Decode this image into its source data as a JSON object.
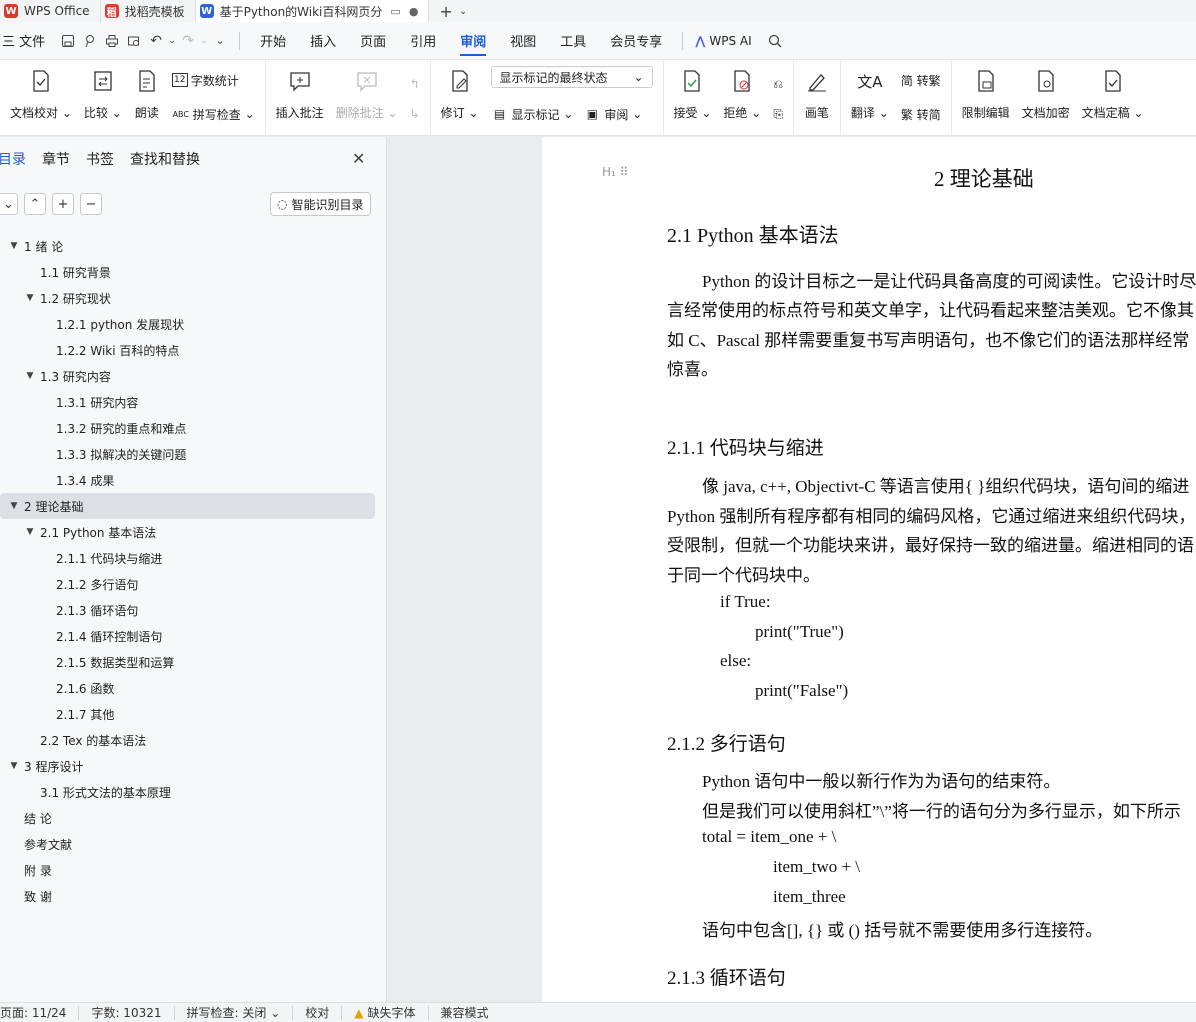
{
  "tabs": [
    {
      "label": "WPS Office",
      "color": "#d83b2a",
      "glyph": "W"
    },
    {
      "label": "找稻壳模板",
      "color": "#e53935",
      "glyph": "稻"
    },
    {
      "label": "基于Python的Wiki百科网页分",
      "color": "#2f64d8",
      "glyph": "W"
    }
  ],
  "menu": {
    "file": "三 文件",
    "items": [
      "开始",
      "插入",
      "页面",
      "引用",
      "审阅",
      "视图",
      "工具",
      "会员专享"
    ],
    "active": "审阅",
    "wps_ai": "WPS AI"
  },
  "ribbon": {
    "doc_check": "文档校对",
    "compare": "比较",
    "read_aloud": "朗读",
    "word_count": "字数统计",
    "spell_check": "拼写检查",
    "insert_comment": "插入批注",
    "delete_comment": "删除批注",
    "revise": "修订",
    "display_state": "显示标记的最终状态",
    "show_markup": "显示标记",
    "review": "审阅",
    "accept": "接受",
    "reject": "拒绝",
    "pen": "画笔",
    "translate": "翻译",
    "to_traditional": "简 转繁",
    "to_simplified": "繁 转简",
    "restrict_edit": "限制编辑",
    "encrypt": "文档加密",
    "finalize": "文档定稿"
  },
  "nav": {
    "tabs": [
      "目录",
      "章节",
      "书签",
      "查找和替换"
    ],
    "smart_toc": "智能识别目录",
    "toc": [
      {
        "level": 1,
        "caret": true,
        "text": "1 绪 论"
      },
      {
        "level": 2,
        "caret": false,
        "text": "1.1 研究背景"
      },
      {
        "level": 2,
        "caret": true,
        "text": "1.2 研究现状"
      },
      {
        "level": 3,
        "caret": false,
        "text": "1.2.1 python 发展现状"
      },
      {
        "level": 3,
        "caret": false,
        "text": "1.2.2 Wiki 百科的特点"
      },
      {
        "level": 2,
        "caret": true,
        "text": "1.3 研究内容"
      },
      {
        "level": 3,
        "caret": false,
        "text": "1.3.1 研究内容"
      },
      {
        "level": 3,
        "caret": false,
        "text": "1.3.2 研究的重点和难点"
      },
      {
        "level": 3,
        "caret": false,
        "text": "1.3.3 拟解决的关键问题"
      },
      {
        "level": 3,
        "caret": false,
        "text": "1.3.4 成果"
      },
      {
        "level": 1,
        "caret": true,
        "text": "2 理论基础",
        "selected": true
      },
      {
        "level": 2,
        "caret": true,
        "text": "2.1 Python 基本语法"
      },
      {
        "level": 3,
        "caret": false,
        "text": "2.1.1 代码块与缩进"
      },
      {
        "level": 3,
        "caret": false,
        "text": "2.1.2 多行语句"
      },
      {
        "level": 3,
        "caret": false,
        "text": "2.1.3 循环语句"
      },
      {
        "level": 3,
        "caret": false,
        "text": "2.1.4 循环控制语句"
      },
      {
        "level": 3,
        "caret": false,
        "text": "2.1.5 数据类型和运算"
      },
      {
        "level": 3,
        "caret": false,
        "text": "2.1.6 函数"
      },
      {
        "level": 3,
        "caret": false,
        "text": "2.1.7 其他"
      },
      {
        "level": 2,
        "caret": false,
        "text": "2.2 Tex 的基本语法"
      },
      {
        "level": 1,
        "caret": true,
        "text": "3 程序设计"
      },
      {
        "level": 2,
        "caret": false,
        "text": "3.1 形式文法的基本原理"
      },
      {
        "level": 1,
        "caret": false,
        "text": "结 论"
      },
      {
        "level": 1,
        "caret": false,
        "text": "参考文献"
      },
      {
        "level": 1,
        "caret": false,
        "text": "附 录"
      },
      {
        "level": 1,
        "caret": false,
        "text": "致 谢"
      }
    ]
  },
  "doc": {
    "chapter_title": "2 理论基础",
    "sec_2_1": "2.1 Python 基本语法",
    "p1": [
      "Python 的设计目标之一是让代码具备高度的可阅读性。它设计时尽",
      "言经常使用的标点符号和英文单字，让代码看起来整洁美观。它不像其",
      "如 C、Pascal 那样需要重复书写声明语句，也不像它们的语法那样经常",
      "惊喜。"
    ],
    "sec_2_1_1": "2.1.1 代码块与缩进",
    "p2": [
      "像 java, c++, Objectivt-C 等语言使用{ }组织代码块，语句间的缩进",
      "Python 强制所有程序都有相同的编码风格，它通过缩进来组织代码块，",
      "受限制，但就一个功能块来讲，最好保持一致的缩进量。缩进相同的语",
      "于同一个代码块中。"
    ],
    "code1": [
      "if True:",
      "print(\"True\")",
      "else:",
      "print(\"False\")"
    ],
    "sec_2_1_2": "2.1.2 多行语句",
    "p3": [
      "Python 语句中一般以新行作为为语句的结束符。",
      "但是我们可以使用斜杠”\\”将一行的语句分为多行显示，如下所示"
    ],
    "code2": [
      "total = item_one + \\",
      "item_two + \\",
      "item_three"
    ],
    "p4": "语句中包含[], {} 或 () 括号就不需要使用多行连接符。",
    "sec_2_1_3": "2.1.3 循环语句"
  },
  "status": {
    "page": "页面: 11/24",
    "words": "字数: 10321",
    "spell": "拼写检查: 关闭",
    "proof": "校对",
    "missing_font": "缺失字体",
    "compat": "兼容模式"
  },
  "colors": {
    "accent": "#1f5fd6"
  }
}
